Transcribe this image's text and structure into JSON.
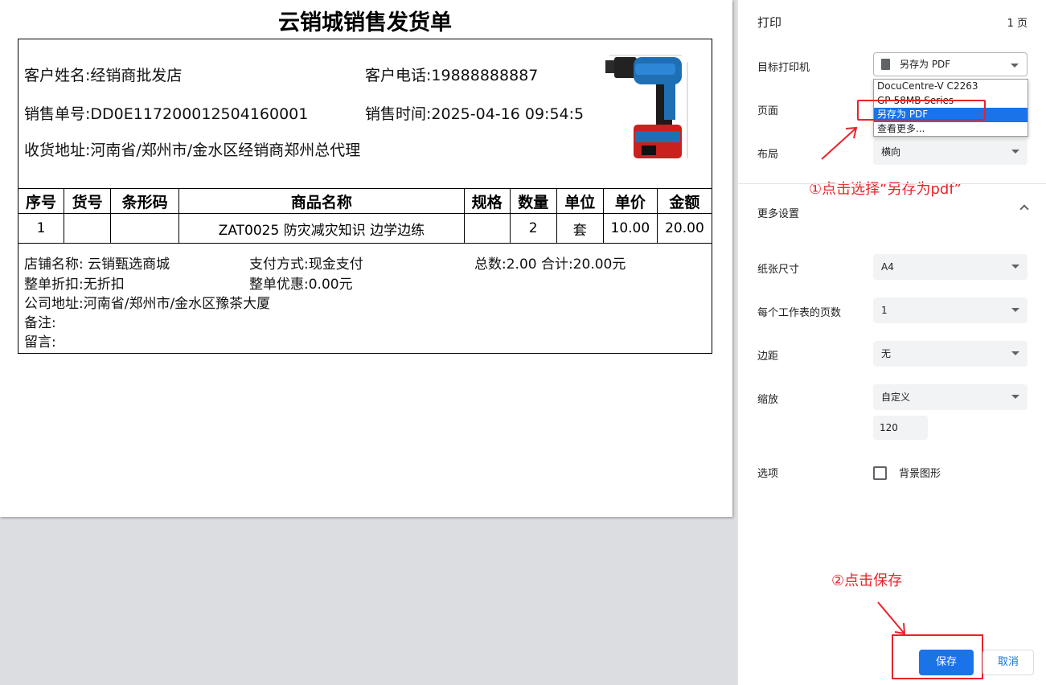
{
  "document": {
    "title": "云销城销售发货单",
    "customer_name": "客户姓名:经销商批发店",
    "customer_phone": "客户电话:19888888887",
    "order_no": "销售单号:DD0E117200012504160001",
    "sale_time": "销售时间:2025-04-16 09:54:5",
    "address": "收货地址:河南省/郑州市/金水区经销商郑州总代理",
    "table": {
      "headers": [
        "序号",
        "货号",
        "条形码",
        "商品名称",
        "规格",
        "数量",
        "单位",
        "单价",
        "金额"
      ],
      "rows": [
        [
          "1",
          "",
          "",
          "ZAT0025 防灾减灾知识 边学边练",
          "",
          "2",
          "套",
          "10.00",
          "20.00"
        ]
      ]
    },
    "footer": {
      "shop": "店铺名称: 云销甄选商城",
      "payment": "支付方式:现金支付",
      "totals": "总数:2.00 合计:20.00元",
      "discount": "整单折扣:无折扣",
      "coupon": "整单优惠:0.00元",
      "company_address": "公司地址:河南省/郑州市/金水区豫茶大厦",
      "remark": "备注:",
      "message": "留言:"
    }
  },
  "print_panel": {
    "title": "打印",
    "page_count": "1 页",
    "destination_label": "目标打印机",
    "destination_value": "另存为 PDF",
    "destination_options": [
      "DocuCentre-V C2263",
      "GP-58MB Series",
      "另存为 PDF",
      "查看更多..."
    ],
    "pages_label": "页面",
    "layout_label": "布局",
    "layout_value": "横向",
    "more_settings_label": "更多设置",
    "paper_size_label": "纸张尺寸",
    "paper_size_value": "A4",
    "pages_per_sheet_label": "每个工作表的页数",
    "pages_per_sheet_value": "1",
    "margins_label": "边距",
    "margins_value": "无",
    "scale_label": "缩放",
    "scale_value": "自定义",
    "scale_custom": "120",
    "options_label": "选项",
    "background_graphics_label": "背景图形",
    "save_label": "保存",
    "cancel_label": "取消",
    "annotation_1": "①点击选择“另存为pdf”",
    "annotation_2": "②点击保存",
    "annotation_color": "#e8232a",
    "accent_color": "#1a73e8"
  }
}
